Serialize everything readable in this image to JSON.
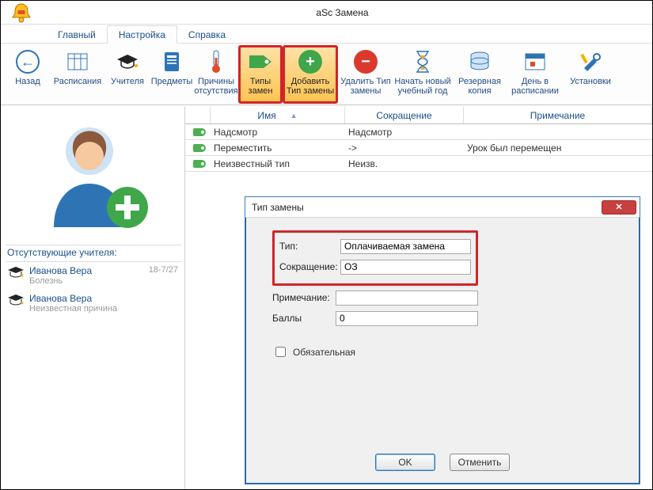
{
  "app_title": "aSc Замена",
  "tabs": {
    "main": "Главный",
    "settings": "Настройка",
    "help": "Справка"
  },
  "ribbon": {
    "back": "Назад",
    "schedules": "Расписания",
    "teachers": "Учителя",
    "subjects": "Предметы",
    "reasons": "Причины отсутствия",
    "types": "Типы замен",
    "add_type": "Добавить Тип замены",
    "del_type": "Удалить Тип замены",
    "new_year": "Начать новый учебный год",
    "backup": "Резервная копия",
    "day": "День в расписании",
    "settings": "Установки"
  },
  "grid": {
    "head": {
      "name": "Имя",
      "abbr": "Сокращение",
      "note": "Примечание"
    },
    "rows": [
      {
        "name": "Надсмотр",
        "abbr": "Надсмотр",
        "note": ""
      },
      {
        "name": "Переместить",
        "abbr": "->",
        "note": "Урок был перемещен"
      },
      {
        "name": "Неизвестный тип",
        "abbr": "Неизв.",
        "note": ""
      }
    ]
  },
  "sidebar": {
    "title": "Отсутствующие учителя:",
    "items": [
      {
        "name": "Иванова Вера",
        "reason": "Болезнь",
        "meta": "18-7/27"
      },
      {
        "name": "Иванова Вера",
        "reason": "Неизвестная причина",
        "meta": ""
      }
    ]
  },
  "dialog": {
    "title": "Тип замены",
    "type_label": "Тип:",
    "type_value": "Оплачиваемая замена",
    "abbr_label": "Сокращение:",
    "abbr_value": "ОЗ",
    "note_label": "Примечание:",
    "note_value": "",
    "points_label": "Баллы",
    "points_value": "0",
    "mandatory_label": "Обязательная",
    "ok": "OK",
    "cancel": "Отменить"
  }
}
